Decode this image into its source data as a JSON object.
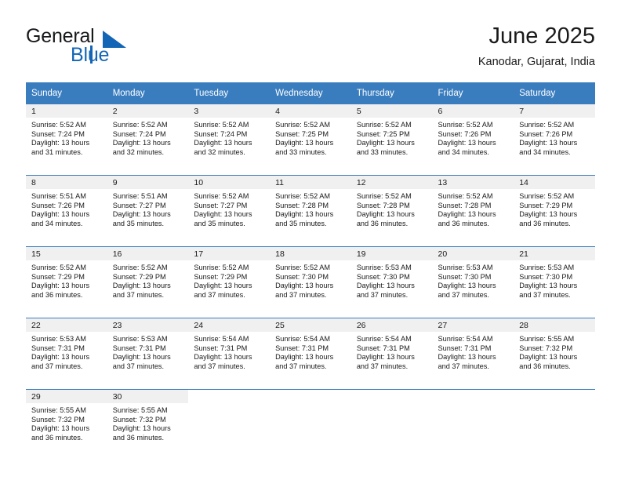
{
  "brand": {
    "name_part1": "General",
    "name_part2": "Blue",
    "logo_color": "#1266b5"
  },
  "header": {
    "month_title": "June 2025",
    "location": "Kanodar, Gujarat, India"
  },
  "theme": {
    "header_row_bg": "#3a7dbf",
    "daynum_band_bg": "#f0f0f0",
    "row_separator": "#3a7dbf",
    "text_color": "#1a1a1a"
  },
  "calendar": {
    "weekday_headers": [
      "Sunday",
      "Monday",
      "Tuesday",
      "Wednesday",
      "Thursday",
      "Friday",
      "Saturday"
    ],
    "weeks": [
      [
        {
          "day": "1",
          "sunrise": "Sunrise: 5:52 AM",
          "sunset": "Sunset: 7:24 PM",
          "daylight1": "Daylight: 13 hours",
          "daylight2": "and 31 minutes."
        },
        {
          "day": "2",
          "sunrise": "Sunrise: 5:52 AM",
          "sunset": "Sunset: 7:24 PM",
          "daylight1": "Daylight: 13 hours",
          "daylight2": "and 32 minutes."
        },
        {
          "day": "3",
          "sunrise": "Sunrise: 5:52 AM",
          "sunset": "Sunset: 7:24 PM",
          "daylight1": "Daylight: 13 hours",
          "daylight2": "and 32 minutes."
        },
        {
          "day": "4",
          "sunrise": "Sunrise: 5:52 AM",
          "sunset": "Sunset: 7:25 PM",
          "daylight1": "Daylight: 13 hours",
          "daylight2": "and 33 minutes."
        },
        {
          "day": "5",
          "sunrise": "Sunrise: 5:52 AM",
          "sunset": "Sunset: 7:25 PM",
          "daylight1": "Daylight: 13 hours",
          "daylight2": "and 33 minutes."
        },
        {
          "day": "6",
          "sunrise": "Sunrise: 5:52 AM",
          "sunset": "Sunset: 7:26 PM",
          "daylight1": "Daylight: 13 hours",
          "daylight2": "and 34 minutes."
        },
        {
          "day": "7",
          "sunrise": "Sunrise: 5:52 AM",
          "sunset": "Sunset: 7:26 PM",
          "daylight1": "Daylight: 13 hours",
          "daylight2": "and 34 minutes."
        }
      ],
      [
        {
          "day": "8",
          "sunrise": "Sunrise: 5:51 AM",
          "sunset": "Sunset: 7:26 PM",
          "daylight1": "Daylight: 13 hours",
          "daylight2": "and 34 minutes."
        },
        {
          "day": "9",
          "sunrise": "Sunrise: 5:51 AM",
          "sunset": "Sunset: 7:27 PM",
          "daylight1": "Daylight: 13 hours",
          "daylight2": "and 35 minutes."
        },
        {
          "day": "10",
          "sunrise": "Sunrise: 5:52 AM",
          "sunset": "Sunset: 7:27 PM",
          "daylight1": "Daylight: 13 hours",
          "daylight2": "and 35 minutes."
        },
        {
          "day": "11",
          "sunrise": "Sunrise: 5:52 AM",
          "sunset": "Sunset: 7:28 PM",
          "daylight1": "Daylight: 13 hours",
          "daylight2": "and 35 minutes."
        },
        {
          "day": "12",
          "sunrise": "Sunrise: 5:52 AM",
          "sunset": "Sunset: 7:28 PM",
          "daylight1": "Daylight: 13 hours",
          "daylight2": "and 36 minutes."
        },
        {
          "day": "13",
          "sunrise": "Sunrise: 5:52 AM",
          "sunset": "Sunset: 7:28 PM",
          "daylight1": "Daylight: 13 hours",
          "daylight2": "and 36 minutes."
        },
        {
          "day": "14",
          "sunrise": "Sunrise: 5:52 AM",
          "sunset": "Sunset: 7:29 PM",
          "daylight1": "Daylight: 13 hours",
          "daylight2": "and 36 minutes."
        }
      ],
      [
        {
          "day": "15",
          "sunrise": "Sunrise: 5:52 AM",
          "sunset": "Sunset: 7:29 PM",
          "daylight1": "Daylight: 13 hours",
          "daylight2": "and 36 minutes."
        },
        {
          "day": "16",
          "sunrise": "Sunrise: 5:52 AM",
          "sunset": "Sunset: 7:29 PM",
          "daylight1": "Daylight: 13 hours",
          "daylight2": "and 37 minutes."
        },
        {
          "day": "17",
          "sunrise": "Sunrise: 5:52 AM",
          "sunset": "Sunset: 7:29 PM",
          "daylight1": "Daylight: 13 hours",
          "daylight2": "and 37 minutes."
        },
        {
          "day": "18",
          "sunrise": "Sunrise: 5:52 AM",
          "sunset": "Sunset: 7:30 PM",
          "daylight1": "Daylight: 13 hours",
          "daylight2": "and 37 minutes."
        },
        {
          "day": "19",
          "sunrise": "Sunrise: 5:53 AM",
          "sunset": "Sunset: 7:30 PM",
          "daylight1": "Daylight: 13 hours",
          "daylight2": "and 37 minutes."
        },
        {
          "day": "20",
          "sunrise": "Sunrise: 5:53 AM",
          "sunset": "Sunset: 7:30 PM",
          "daylight1": "Daylight: 13 hours",
          "daylight2": "and 37 minutes."
        },
        {
          "day": "21",
          "sunrise": "Sunrise: 5:53 AM",
          "sunset": "Sunset: 7:30 PM",
          "daylight1": "Daylight: 13 hours",
          "daylight2": "and 37 minutes."
        }
      ],
      [
        {
          "day": "22",
          "sunrise": "Sunrise: 5:53 AM",
          "sunset": "Sunset: 7:31 PM",
          "daylight1": "Daylight: 13 hours",
          "daylight2": "and 37 minutes."
        },
        {
          "day": "23",
          "sunrise": "Sunrise: 5:53 AM",
          "sunset": "Sunset: 7:31 PM",
          "daylight1": "Daylight: 13 hours",
          "daylight2": "and 37 minutes."
        },
        {
          "day": "24",
          "sunrise": "Sunrise: 5:54 AM",
          "sunset": "Sunset: 7:31 PM",
          "daylight1": "Daylight: 13 hours",
          "daylight2": "and 37 minutes."
        },
        {
          "day": "25",
          "sunrise": "Sunrise: 5:54 AM",
          "sunset": "Sunset: 7:31 PM",
          "daylight1": "Daylight: 13 hours",
          "daylight2": "and 37 minutes."
        },
        {
          "day": "26",
          "sunrise": "Sunrise: 5:54 AM",
          "sunset": "Sunset: 7:31 PM",
          "daylight1": "Daylight: 13 hours",
          "daylight2": "and 37 minutes."
        },
        {
          "day": "27",
          "sunrise": "Sunrise: 5:54 AM",
          "sunset": "Sunset: 7:31 PM",
          "daylight1": "Daylight: 13 hours",
          "daylight2": "and 37 minutes."
        },
        {
          "day": "28",
          "sunrise": "Sunrise: 5:55 AM",
          "sunset": "Sunset: 7:32 PM",
          "daylight1": "Daylight: 13 hours",
          "daylight2": "and 36 minutes."
        }
      ],
      [
        {
          "day": "29",
          "sunrise": "Sunrise: 5:55 AM",
          "sunset": "Sunset: 7:32 PM",
          "daylight1": "Daylight: 13 hours",
          "daylight2": "and 36 minutes."
        },
        {
          "day": "30",
          "sunrise": "Sunrise: 5:55 AM",
          "sunset": "Sunset: 7:32 PM",
          "daylight1": "Daylight: 13 hours",
          "daylight2": "and 36 minutes."
        },
        {
          "day": "",
          "sunrise": "",
          "sunset": "",
          "daylight1": "",
          "daylight2": ""
        },
        {
          "day": "",
          "sunrise": "",
          "sunset": "",
          "daylight1": "",
          "daylight2": ""
        },
        {
          "day": "",
          "sunrise": "",
          "sunset": "",
          "daylight1": "",
          "daylight2": ""
        },
        {
          "day": "",
          "sunrise": "",
          "sunset": "",
          "daylight1": "",
          "daylight2": ""
        },
        {
          "day": "",
          "sunrise": "",
          "sunset": "",
          "daylight1": "",
          "daylight2": ""
        }
      ]
    ]
  }
}
